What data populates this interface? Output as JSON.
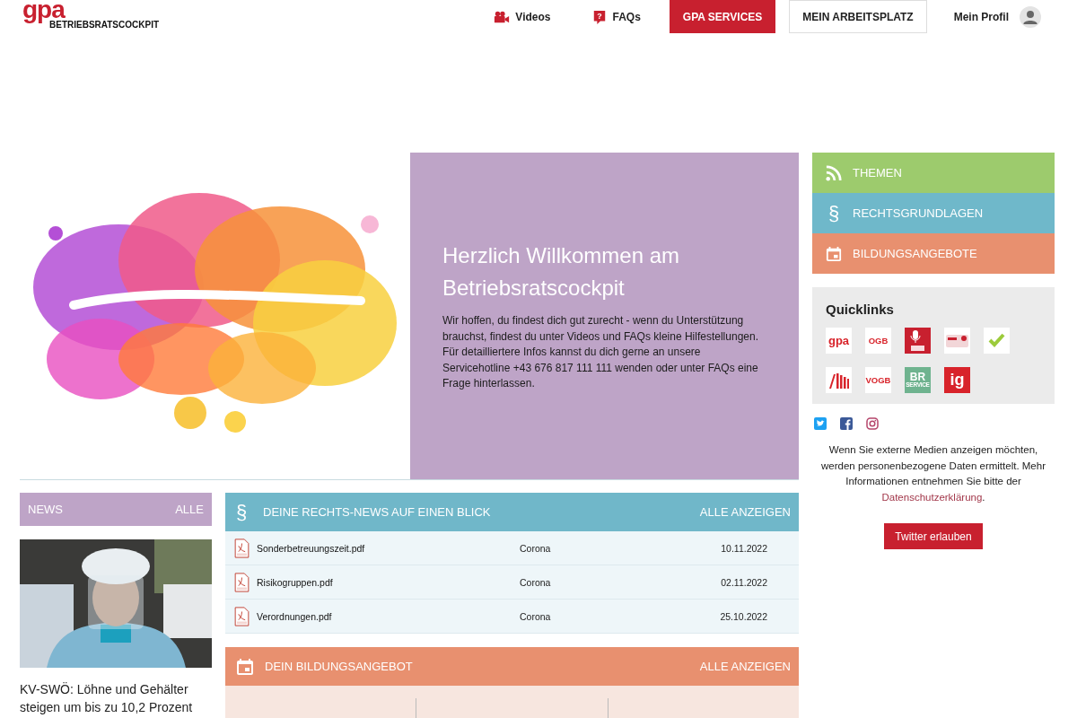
{
  "header": {
    "logo": {
      "mark": "gpa",
      "subtitle": "BETRIEBSRATSCOCKPIT"
    },
    "nav": [
      {
        "label": "Videos",
        "kind": "video"
      },
      {
        "label": "FAQs",
        "kind": "faq",
        "icon": "?"
      },
      {
        "label": "GPA SERVICES",
        "kind": "primary"
      },
      {
        "label": "MEIN ARBEITSPLATZ",
        "kind": "outline"
      },
      {
        "label": "Mein Profil",
        "kind": "profile"
      }
    ]
  },
  "hero": {
    "title": "Herzlich Willkommen am Betriebsratscockpit",
    "text": "Wir hoffen, du findest dich gut zurecht - wenn du Unterstützung brauchst, findest du unter Videos und FAQs kleine Hilfestellungen. Für detailliertere Infos kannst du dich gerne an unsere Servicehotline +43 676 817 111 111 wenden oder unter FAQs eine Frage hinterlassen."
  },
  "side_menu": [
    {
      "label": "THEMEN",
      "kind": "rss",
      "color": "#9dcb6d"
    },
    {
      "label": "RECHTSGRUNDLAGEN",
      "kind": "paragraph",
      "icon": "§",
      "color": "#6fb8ca"
    },
    {
      "label": "BILDUNGSANGEBOTE",
      "kind": "calendar",
      "color": "#e8906f"
    }
  ],
  "quicklinks": {
    "title": "Quicklinks",
    "items": [
      {
        "kind": "gpa",
        "label": "gpa"
      },
      {
        "kind": "ogb",
        "label": "OGB"
      },
      {
        "kind": "podcast"
      },
      {
        "kind": "card"
      },
      {
        "kind": "check"
      },
      {
        "kind": "books"
      },
      {
        "kind": "vogb",
        "label": "VOGB"
      },
      {
        "kind": "br",
        "label": "BR",
        "sublabel": "SERVICE"
      },
      {
        "kind": "ig",
        "label": "ig"
      }
    ]
  },
  "social": [
    {
      "kind": "twitter"
    },
    {
      "kind": "facebook"
    },
    {
      "kind": "instagram"
    }
  ],
  "privacy": {
    "text": "Wenn Sie externe Medien anzeigen möchten, werden personenbezogene Daten ermittelt. Mehr Informationen entnehmen Sie bitte der",
    "link": "Datenschutzerklärung",
    "link_suffix": ".",
    "button": "Twitter erlauben"
  },
  "news": {
    "title": "NEWS",
    "more": "ALLE",
    "items": [
      {
        "headline": "KV-SWÖ: Löhne und Gehälter steigen um bis zu 10,2 Prozent"
      }
    ]
  },
  "legal_news": {
    "icon": "§",
    "title": "DEINE RECHTS-NEWS AUF EINEN BLICK",
    "more": "ALLE ANZEIGEN",
    "rows": [
      {
        "file": "Sonderbetreuungszeit.pdf",
        "topic": "Corona",
        "date": "10.11.2022"
      },
      {
        "file": "Risikogruppen.pdf",
        "topic": "Corona",
        "date": "02.11.2022"
      },
      {
        "file": "Verordnungen.pdf",
        "topic": "Corona",
        "date": "25.10.2022"
      }
    ]
  },
  "education": {
    "title": "DEIN BILDUNGSANGEBOT",
    "more": "ALLE ANZEIGEN"
  }
}
